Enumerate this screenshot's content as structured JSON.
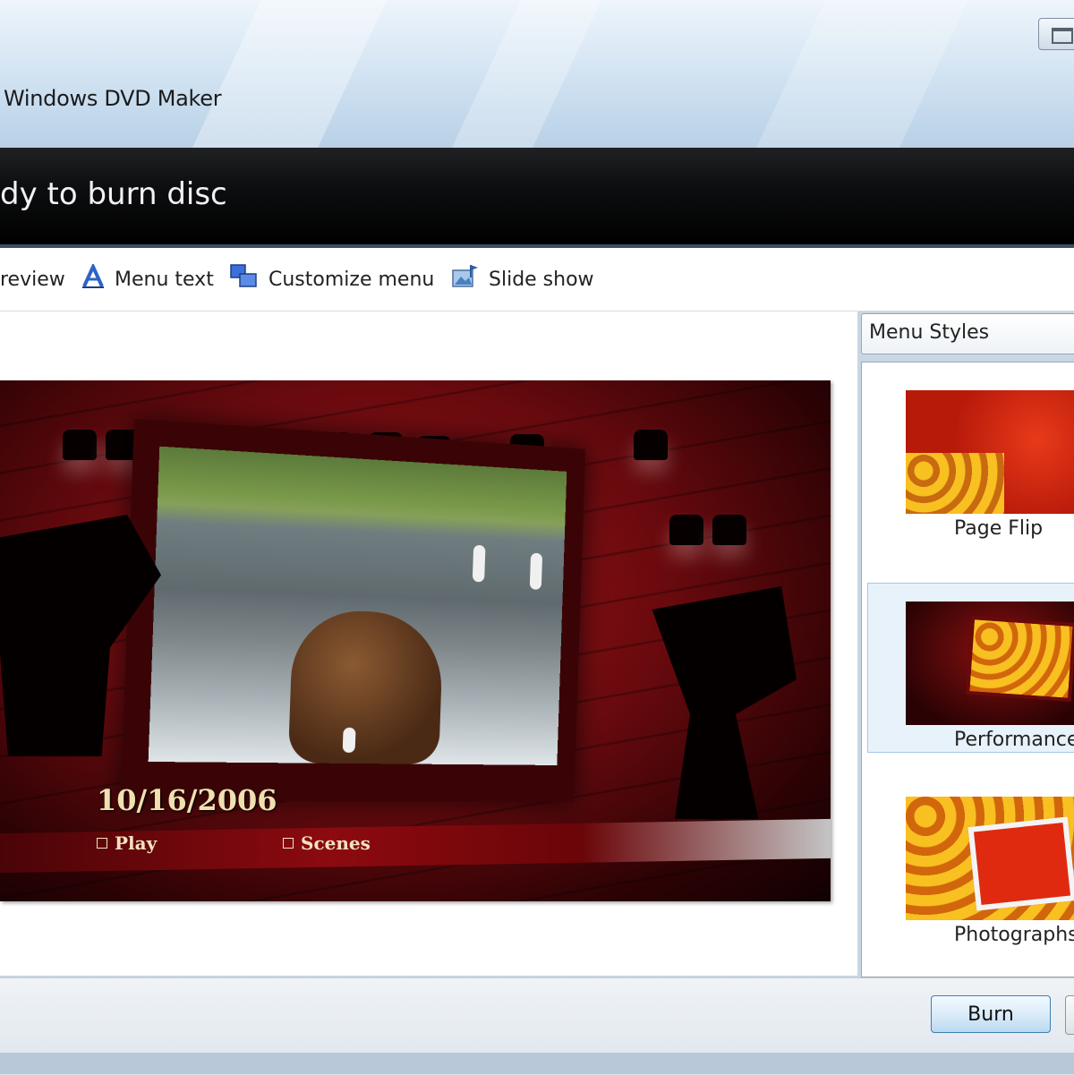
{
  "window": {
    "title": "Windows DVD Maker"
  },
  "header": {
    "title": "dy to burn disc"
  },
  "toolbar": {
    "preview_label": "review",
    "menu_text_label": "Menu text",
    "customize_menu_label": "Customize menu",
    "slide_show_label": "Slide show"
  },
  "preview": {
    "date": "10/16/2006",
    "play_label": "Play",
    "scenes_label": "Scenes"
  },
  "styles": {
    "dropdown_value": "Menu Styles",
    "items": [
      {
        "label": "Page Flip",
        "selected": false
      },
      {
        "label": "Performance",
        "selected": true
      },
      {
        "label": "Photographs",
        "selected": false
      }
    ]
  },
  "footer": {
    "burn_label": "Burn"
  },
  "colors": {
    "accent": "#3c7fb1",
    "banner": "#0d0e10",
    "selection": "#e8f2fb"
  }
}
